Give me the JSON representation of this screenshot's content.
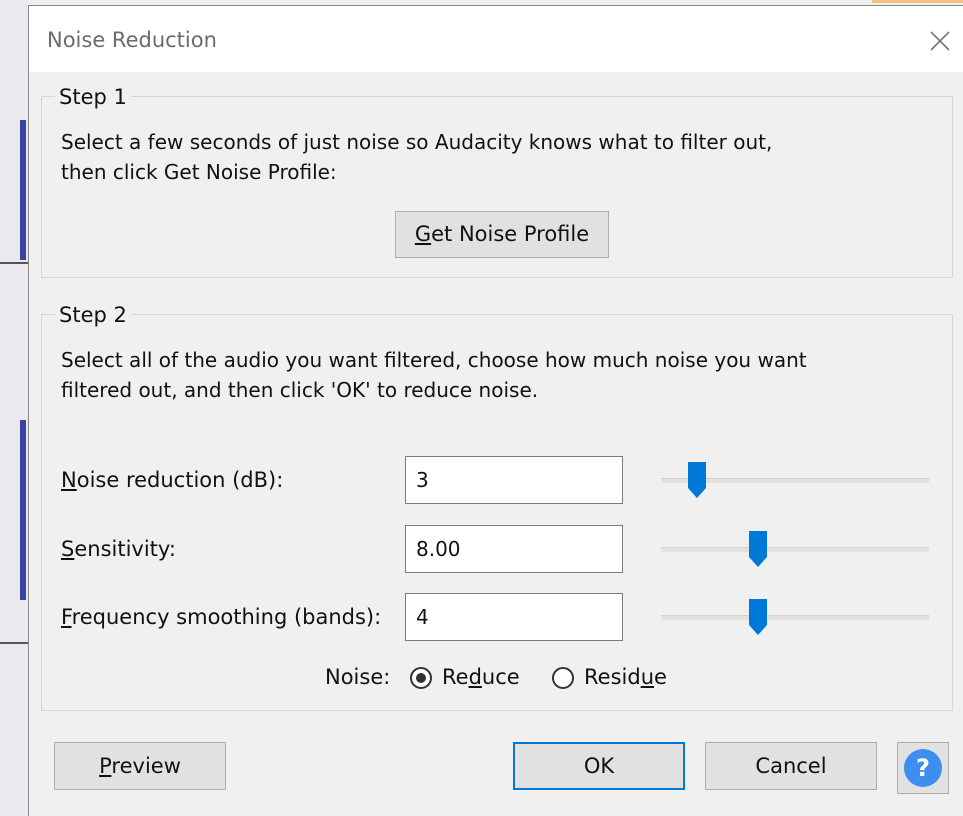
{
  "window": {
    "title": "Noise Reduction",
    "close_icon": "close-icon"
  },
  "step1": {
    "legend": "Step 1",
    "description_line1": "Select a few seconds of just noise so Audacity knows what to filter out,",
    "description_line2": "then click Get Noise Profile:",
    "get_profile_button": {
      "accel": "G",
      "rest": "et Noise Profile"
    }
  },
  "step2": {
    "legend": "Step 2",
    "description_line1": "Select all of the audio you want filtered, choose how much noise you want",
    "description_line2": "filtered out, and then click 'OK' to reduce noise.",
    "noise_reduction": {
      "label_accel": "N",
      "label_rest": "oise reduction (dB):",
      "value": "3",
      "slider_level": 0.1
    },
    "sensitivity": {
      "label_accel": "S",
      "label_rest": "ensitivity:",
      "value": "8.00",
      "slider_level": 0.35
    },
    "frequency_smoothing": {
      "label_accel": "F",
      "label_rest": "requency smoothing (bands):",
      "value": "4",
      "slider_level": 0.35
    },
    "noise_option": {
      "label": "Noise:",
      "reduce_pre": "Re",
      "reduce_accel": "d",
      "reduce_post": "uce",
      "residue_pre": "Resid",
      "residue_accel": "u",
      "residue_post": "e",
      "selected": "reduce"
    }
  },
  "footer": {
    "preview_accel": "P",
    "preview_rest": "review",
    "ok_label": "OK",
    "cancel_label": "Cancel",
    "help_icon": "help-icon"
  },
  "colors": {
    "accent": "#0078d7",
    "help_blue": "#3d8ef0"
  }
}
